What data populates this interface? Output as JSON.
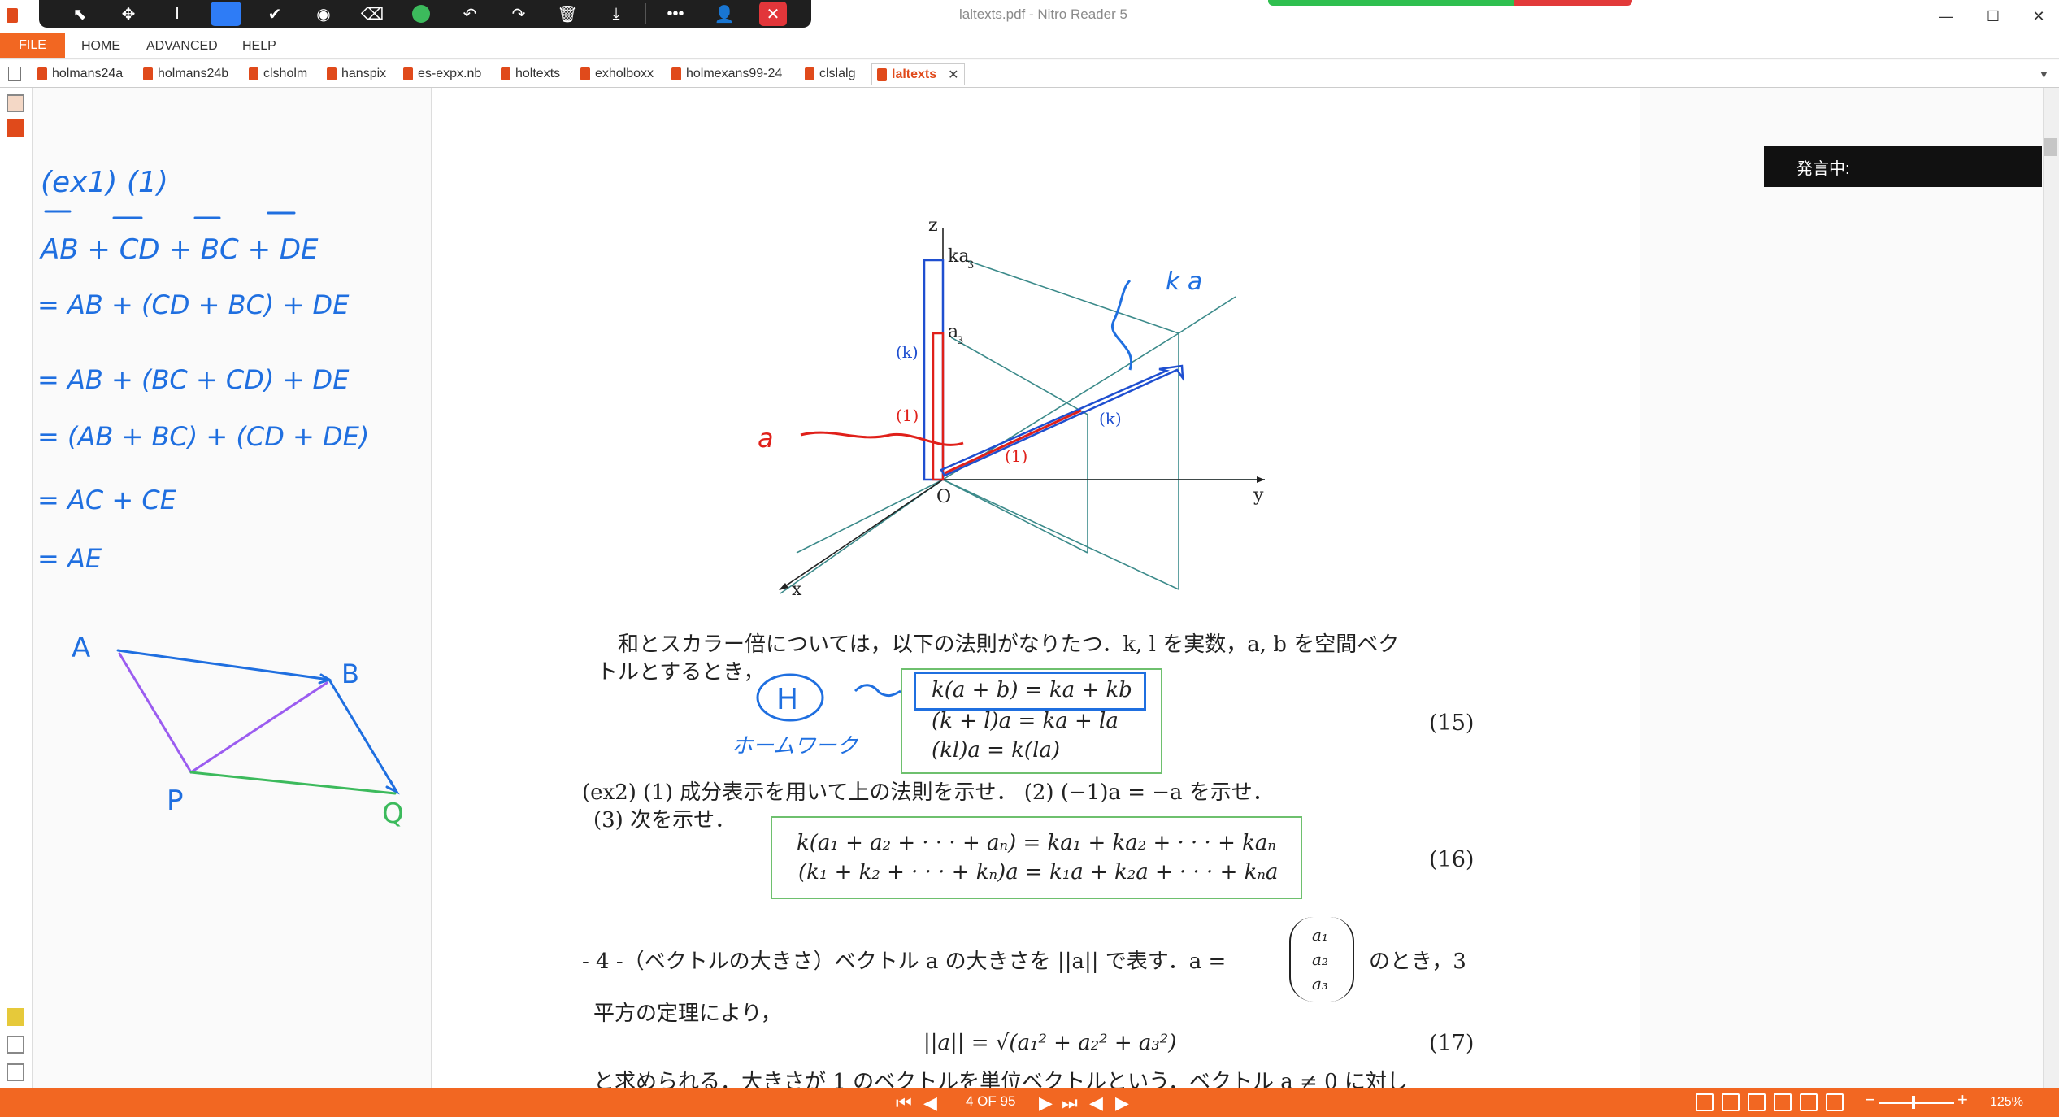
{
  "window": {
    "title": "laltexts.pdf - Nitro Reader 5",
    "minimize_icon": "minimize-icon",
    "maximize_icon": "maximize-icon",
    "close_icon": "close-icon"
  },
  "annotation_toolbar": {
    "tools": [
      "select-arrow-icon",
      "move-icon",
      "text-cursor-icon",
      "rectangle-icon",
      "check-icon",
      "circle-icon",
      "eraser-icon",
      "color-dot-icon",
      "undo-icon",
      "redo-icon",
      "trash-icon",
      "download-icon",
      "more-icon",
      "person-settings-icon",
      "close-icon"
    ],
    "active_color": "#2e7cf6",
    "pen_color": "#3cba5c"
  },
  "menu": {
    "file": "FILE",
    "home": "HOME",
    "advanced": "ADVANCED",
    "help": "HELP"
  },
  "tabs": [
    "holmans24a",
    "holmans24b",
    "clsholm",
    "hanspix",
    "es-expx.nb",
    "holtexts",
    "exholboxx",
    "holmexans99-24",
    "clslalg",
    "laltexts"
  ],
  "active_tab": "laltexts",
  "right_panel": {
    "speaking_label": "発言中:"
  },
  "handwriting_left": {
    "lines": [
      "(ex1) (1)",
      "AB + CD + BC + DE",
      "= AB + (CD + BC) + DE",
      "= AB + (BC + CD) + DE",
      "= (AB + BC) + (CD + DE)",
      "= AC + CE",
      "= AE"
    ],
    "points": [
      "A",
      "B",
      "P",
      "Q"
    ]
  },
  "document": {
    "figure": {
      "axis_z": "z",
      "axis_y": "y",
      "axis_x": "x",
      "origin": "O",
      "label_ka3": "ka",
      "label_ka3_sub": "3",
      "label_a3": "a",
      "label_a3_sub": "3",
      "label_k_blue_left": "(k)",
      "label_1_red_left": "(1)",
      "label_k_blue_right": "(k)",
      "label_1_red_right": "(1)",
      "handwritten_ka": "k a",
      "handwritten_a": "a"
    },
    "para1_line1": "和とスカラー倍については，以下の法則がなりたつ．k, l を実数，a, b を空間ベク",
    "para1_line2": "トルとするとき，",
    "handwritten_H": "H",
    "handwritten_homework": "ホームワーク",
    "eq15": [
      "k(a + b) = ka + kb",
      "(k + l)a = ka + la",
      "(kl)a = k(la)"
    ],
    "eq15_no": "(15)",
    "ex2_line1": "(ex2)  (1) 成分表示を用いて上の法則を示せ．  (2) (−1)a = −a を示せ．",
    "ex2_line2": "(3) 次を示せ．",
    "eq16": [
      "k(a₁ + a₂ + · · · + aₙ) = ka₁ + ka₂ + · · · + kaₙ",
      "(k₁ + k₂ + · · · + kₙ)a = k₁a + k₂a + · · · + kₙa"
    ],
    "eq16_no": "(16)",
    "sec4_line1": "- 4 -（ベクトルの大きさ）ベクトル a の大きさを ||a|| で表す．a =",
    "sec4_line1_end": "のとき，3",
    "vector_components": [
      "a₁",
      "a₂",
      "a₃"
    ],
    "sec4_line2": "平方の定理により，",
    "eq17": "||a|| = √(a₁² + a₂² + a₃²)",
    "eq17_no": "(17)",
    "sec4_line3": "と求められる．大きさが 1 のベクトルを単位ベクトルという．ベクトル a ≠ 0 に対し"
  },
  "status": {
    "page_indicator": "4 OF 95",
    "zoom": "125%",
    "zoom_minus": "−",
    "zoom_plus": "+"
  },
  "colors": {
    "accent": "#f26722",
    "ink_blue": "#1f6fe0",
    "ink_red": "#e0201a",
    "ink_green": "#3cba5c",
    "ink_purple": "#9b5cf0",
    "figure_teal": "#3b8a8a"
  }
}
